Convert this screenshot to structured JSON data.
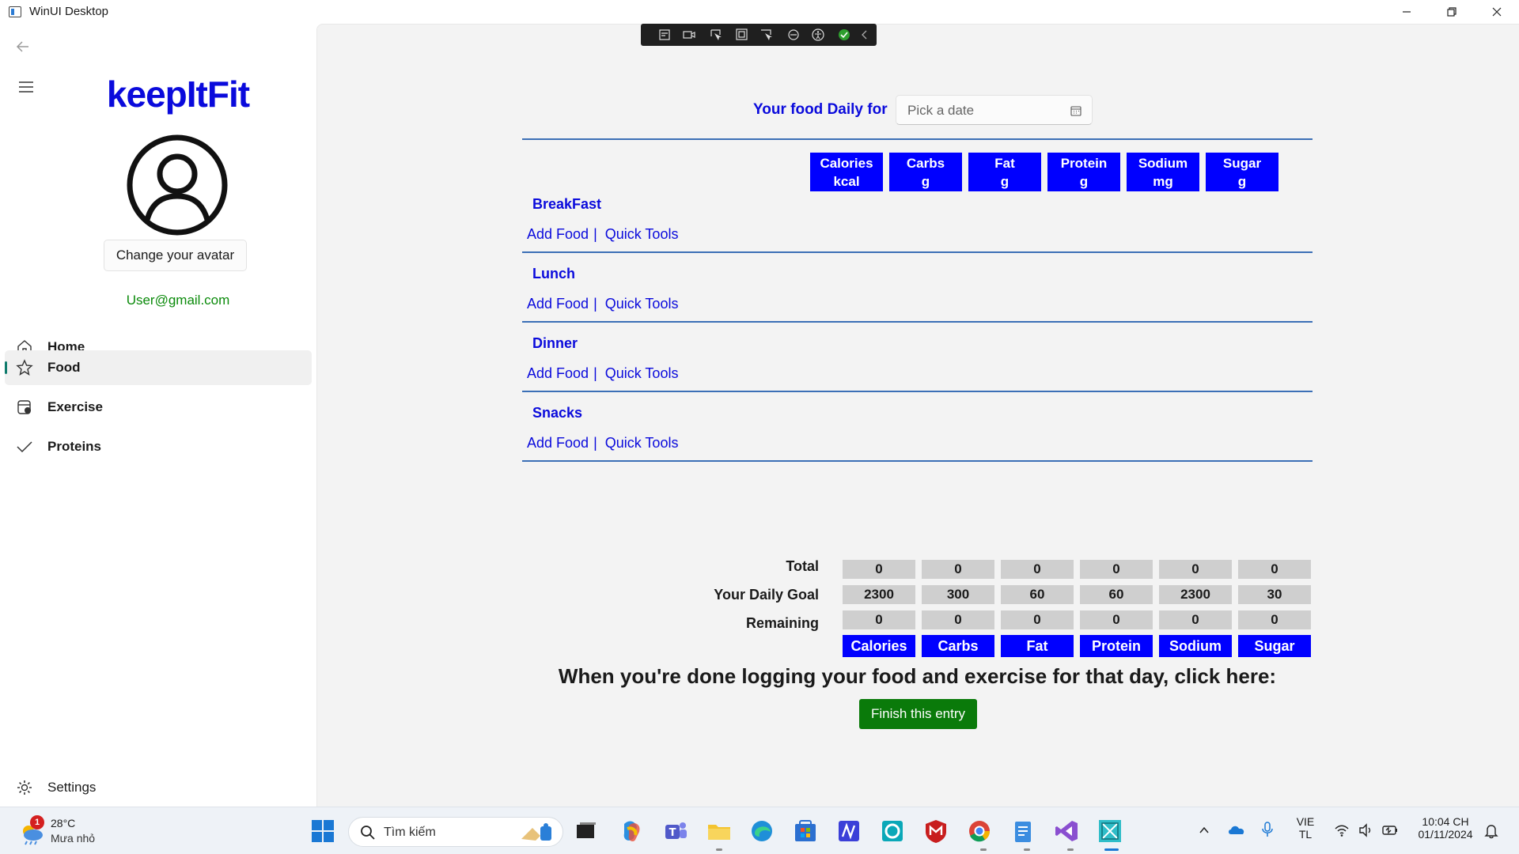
{
  "window": {
    "title": "WinUI Desktop"
  },
  "sidebar": {
    "logo": "keepItFit",
    "avatar_button": "Change your avatar",
    "email": "User@gmail.com",
    "items": [
      {
        "label": "Home",
        "icon": "home-icon"
      },
      {
        "label": "Food",
        "icon": "star-icon",
        "selected": true
      },
      {
        "label": "Exercise",
        "icon": "exercise-icon"
      },
      {
        "label": "Proteins",
        "icon": "checkmark-icon"
      }
    ],
    "settings_label": "Settings"
  },
  "header": {
    "daily_label": "Your food Daily for",
    "date_placeholder": "Pick a date"
  },
  "columns": [
    {
      "name": "Calories",
      "unit": "kcal"
    },
    {
      "name": "Carbs",
      "unit": "g"
    },
    {
      "name": "Fat",
      "unit": "g"
    },
    {
      "name": "Protein",
      "unit": "g"
    },
    {
      "name": "Sodium",
      "unit": "mg"
    },
    {
      "name": "Sugar",
      "unit": "g"
    }
  ],
  "meals": [
    {
      "title": "BreakFast",
      "add": "Add Food",
      "sep": "|",
      "tools": "Quick Tools"
    },
    {
      "title": "Lunch",
      "add": "Add Food",
      "sep": "|",
      "tools": "Quick Tools"
    },
    {
      "title": "Dinner",
      "add": "Add Food",
      "sep": "|",
      "tools": "Quick Tools"
    },
    {
      "title": "Snacks",
      "add": "Add Food",
      "sep": "|",
      "tools": "Quick Tools"
    }
  ],
  "summary": {
    "rows": [
      {
        "label": "Total",
        "values": [
          "0",
          "0",
          "0",
          "0",
          "0",
          "0"
        ]
      },
      {
        "label": "Your Daily Goal",
        "values": [
          "2300",
          "300",
          "60",
          "60",
          "2300",
          "30"
        ]
      },
      {
        "label": "Remaining",
        "values": [
          "0",
          "0",
          "0",
          "0",
          "0",
          "0"
        ]
      }
    ],
    "footer_headers": [
      "Calories",
      "Carbs",
      "Fat",
      "Protein",
      "Sodium",
      "Sugar"
    ]
  },
  "done_message": "When you're done logging your food and exercise for that day, click here:",
  "finish_button": "Finish this entry",
  "taskbar": {
    "weather_temp": "28°C",
    "weather_desc": "Mưa nhỏ",
    "weather_badge": "1",
    "search_placeholder": "Tìm kiếm",
    "lang_top": "VIE",
    "lang_bottom": "TL",
    "time": "10:04 CH",
    "date": "01/11/2024"
  },
  "colors": {
    "accent_blue": "#0000ff",
    "link_blue": "#0a0adc",
    "finish_green": "#0a7a0a",
    "email_green": "#0a8a0a"
  }
}
